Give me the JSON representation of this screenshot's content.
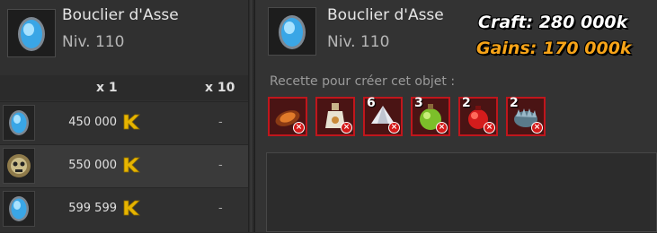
{
  "item": {
    "name": "Bouclier d'Asse",
    "level": "Niv. 110"
  },
  "price_table": {
    "headers": [
      "x 1",
      "x 10"
    ],
    "rows": [
      {
        "icon": "blue-shield-icon",
        "price_x1": "450 000",
        "price_x10": "-"
      },
      {
        "icon": "skull-mask-icon",
        "price_x1": "550 000",
        "price_x10": "-"
      },
      {
        "icon": "blue-shield-icon",
        "price_x1": "599 599",
        "price_x10": "-"
      }
    ]
  },
  "recipe": {
    "label": "Recette pour créer cet objet :",
    "ingredients": [
      {
        "icon": "fried-food-icon",
        "quantity": ""
      },
      {
        "icon": "potion-bottle-icon",
        "quantity": ""
      },
      {
        "icon": "white-gem-icon",
        "quantity": "6"
      },
      {
        "icon": "green-potion-icon",
        "quantity": "3"
      },
      {
        "icon": "red-bag-icon",
        "quantity": "2"
      },
      {
        "icon": "spiky-shell-icon",
        "quantity": "2"
      }
    ]
  },
  "overlay": {
    "craft": "Craft: 280 000k",
    "gains": "Gains: 170 000k"
  },
  "colors": {
    "craft_text": "#ffffff",
    "gains_text": "#f7a418",
    "ingredient_border": "#c0161c",
    "kama_gold": "#e6b400"
  }
}
